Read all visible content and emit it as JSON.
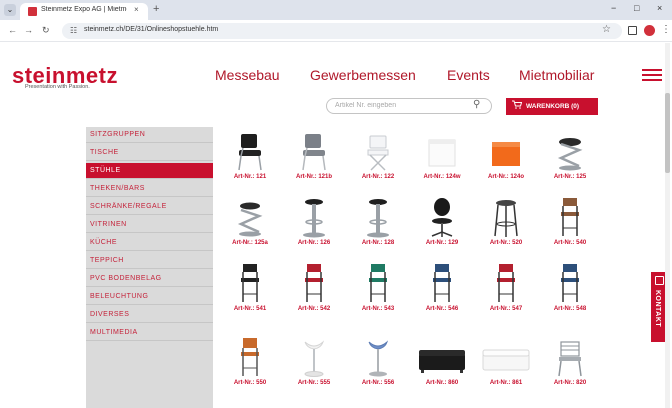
{
  "browser": {
    "tab_title": "Steinmetz Expo AG | Mietmöbl",
    "tab_close": "×",
    "new_tab": "+",
    "url": "steinmetz.ch/DE/31/Onlineshopstuehle.htm",
    "win_minimize": "−",
    "win_maximize": "□",
    "win_close": "×",
    "menu_dots": "⋮"
  },
  "site": {
    "logo": "steinmetz",
    "tagline": "Presentation with Passion.",
    "nav": [
      "Messebau",
      "Gewerbemessen",
      "Events",
      "Mietmobiliar"
    ],
    "search_placeholder": "Artikel Nr. eingeben",
    "cart_label": "WARENKORB (0)"
  },
  "sidebar": {
    "items": [
      {
        "label": "SITZGRUPPEN",
        "active": false
      },
      {
        "label": "TISCHE",
        "active": false
      },
      {
        "label": "STÜHLE",
        "active": true
      },
      {
        "label": "THEKEN/BARS",
        "active": false
      },
      {
        "label": "SCHRÄNKE/REGALE",
        "active": false
      },
      {
        "label": "VITRINEN",
        "active": false
      },
      {
        "label": "KÜCHE",
        "active": false
      },
      {
        "label": "TEPPICH",
        "active": false
      },
      {
        "label": "PVC BODENBELAG",
        "active": false
      },
      {
        "label": "BELEUCHTUNG",
        "active": false
      },
      {
        "label": "DIVERSES",
        "active": false
      },
      {
        "label": "MULTIMEDIA",
        "active": false
      }
    ]
  },
  "products": [
    {
      "label": "Art-Nr.: 121",
      "icon": "black-chair-icon"
    },
    {
      "label": "Art-Nr.: 121b",
      "icon": "grey-chair-icon"
    },
    {
      "label": "Art-Nr.: 122",
      "icon": "white-folding-chair-icon"
    },
    {
      "label": "Art-Nr.: 124w",
      "icon": "white-cube-icon"
    },
    {
      "label": "Art-Nr.: 124o",
      "icon": "orange-cube-icon"
    },
    {
      "label": "Art-Nr.: 125",
      "icon": "z-chair-icon"
    },
    {
      "label": "Art-Nr.: 125a",
      "icon": "z-stool-icon"
    },
    {
      "label": "Art-Nr.: 126",
      "icon": "bar-stool-icon"
    },
    {
      "label": "Art-Nr.: 128",
      "icon": "bar-stool-icon"
    },
    {
      "label": "Art-Nr.: 129",
      "icon": "office-chair-icon"
    },
    {
      "label": "Art-Nr.: 520",
      "icon": "round-stool-icon"
    },
    {
      "label": "Art-Nr.: 540",
      "icon": "wood-bar-chair-icon"
    },
    {
      "label": "Art-Nr.: 541",
      "icon": "black-bar-chair-icon"
    },
    {
      "label": "Art-Nr.: 542",
      "icon": "red-bar-chair-icon"
    },
    {
      "label": "Art-Nr.: 543",
      "icon": "green-bar-chair-icon"
    },
    {
      "label": "Art-Nr.: 546",
      "icon": "blue-bar-chair-icon"
    },
    {
      "label": "Art-Nr.: 547",
      "icon": "red-bar-chair-icon"
    },
    {
      "label": "Art-Nr.: 548",
      "icon": "blue-bar-chair-icon"
    },
    {
      "label": "Art-Nr.: 550",
      "icon": "orange-bar-chair-icon"
    },
    {
      "label": "Art-Nr.: 555",
      "icon": "white-tulip-stool-icon"
    },
    {
      "label": "Art-Nr.: 556",
      "icon": "blue-tulip-stool-icon"
    },
    {
      "label": "Art-Nr.: 860",
      "icon": "black-sofa-icon"
    },
    {
      "label": "Art-Nr.: 861",
      "icon": "white-sofa-icon"
    },
    {
      "label": "Art-Nr.: 820",
      "icon": "aluminium-chair-icon"
    }
  ],
  "kontakt": {
    "label": "KONTAKT"
  },
  "colors": {
    "brand": "#c8102e",
    "sidebar_bg": "#dadada"
  }
}
